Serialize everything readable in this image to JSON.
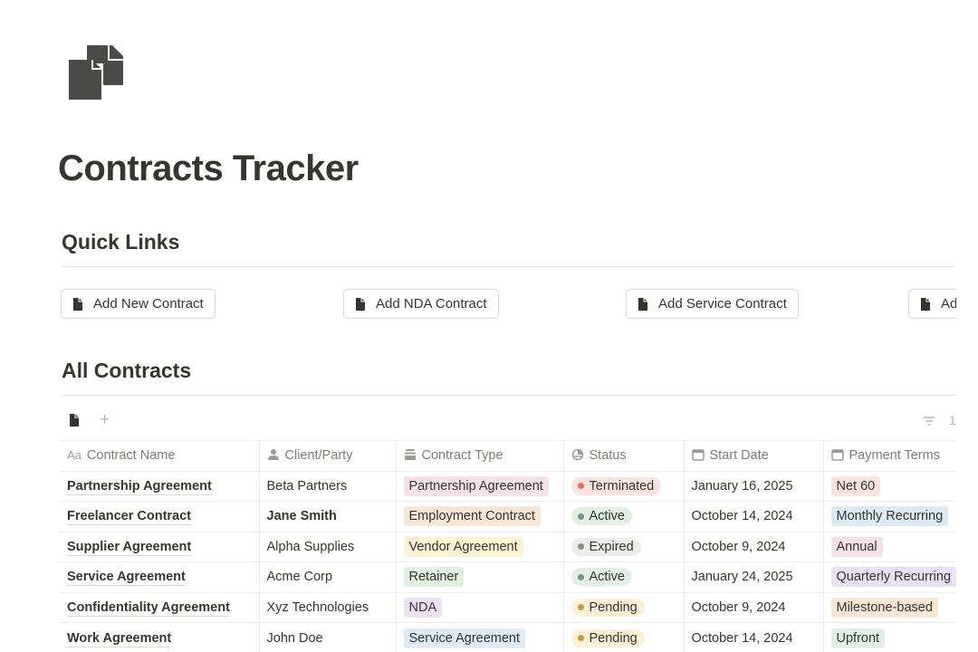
{
  "page": {
    "icon": "documents-icon",
    "title": "Contracts Tracker"
  },
  "quick_links": {
    "heading": "Quick Links",
    "buttons": [
      {
        "label": "Add New Contract",
        "icon": "document-icon"
      },
      {
        "label": "Add NDA Contract",
        "icon": "document-icon"
      },
      {
        "label": "Add Service Contract",
        "icon": "document-icon"
      },
      {
        "label": "Ad",
        "icon": "document-icon"
      }
    ]
  },
  "all_contracts": {
    "heading": "All Contracts",
    "view_bar": {
      "view_icon": "database-view-icon",
      "add_view": "+",
      "filter_icon": "filter-icon",
      "count_text": "1"
    },
    "columns": [
      {
        "label": "Contract Name",
        "icon": "text-property-icon",
        "icon_text": "Aa"
      },
      {
        "label": "Client/Party",
        "icon": "person-icon"
      },
      {
        "label": "Contract Type",
        "icon": "select-icon"
      },
      {
        "label": "Status",
        "icon": "status-icon"
      },
      {
        "label": "Start Date",
        "icon": "calendar-icon"
      },
      {
        "label": "Payment Terms",
        "icon": "calendar-icon"
      }
    ],
    "rows": [
      {
        "name": "Partnership Agreement",
        "client": "Beta Partners",
        "client_bold": false,
        "type": "Partnership Agreement",
        "type_color": "#f6e0ea",
        "status": "Terminated",
        "status_bg": "#fbe3e0",
        "status_dot": "#e16f64",
        "start": "January 16, 2025",
        "payment": "Net 60",
        "payment_color": "#fbe4e0"
      },
      {
        "name": "Freelancer Contract",
        "client": "Jane Smith",
        "client_bold": true,
        "type": "Employment Contract",
        "type_color": "#f8e7d6",
        "status": "Active",
        "status_bg": "#e3efe5",
        "status_dot": "#6c9b7d",
        "start": "October 14, 2024",
        "payment": "Monthly Recurring",
        "payment_color": "#dde9f3"
      },
      {
        "name": "Supplier Agreement",
        "client": "Alpha Supplies",
        "client_bold": false,
        "type": "Vendor Agreement",
        "type_color": "#fbf1d3",
        "status": "Expired",
        "status_bg": "#ececea",
        "status_dot": "#8e8c87",
        "start": "October 9, 2024",
        "payment": "Annual",
        "payment_color": "#f6e0ea"
      },
      {
        "name": "Service Agreement",
        "client": "Acme Corp",
        "client_bold": false,
        "type": "Retainer",
        "type_color": "#e2efe3",
        "status": "Active",
        "status_bg": "#e3efe5",
        "status_dot": "#6c9b7d",
        "start": "January 24, 2025",
        "payment": "Quarterly Recurring",
        "payment_color": "#e9e1f3"
      },
      {
        "name": "Confidentiality Agreement",
        "client": "Xyz Technologies",
        "client_bold": false,
        "type": "NDA",
        "type_color": "#ebe3f4",
        "status": "Pending",
        "status_bg": "#fbefd6",
        "status_dot": "#c69a3f",
        "start": "October 9, 2024",
        "payment": "Milestone-based",
        "payment_color": "#f8e7d6"
      },
      {
        "name": "Work Agreement",
        "client": "John Doe",
        "client_bold": false,
        "type": "Service Agreement",
        "type_color": "#dfeaf4",
        "status": "Pending",
        "status_bg": "#fbefd6",
        "status_dot": "#c69a3f",
        "start": "October 14, 2024",
        "payment": "Upfront",
        "payment_color": "#e2efe3"
      }
    ]
  }
}
